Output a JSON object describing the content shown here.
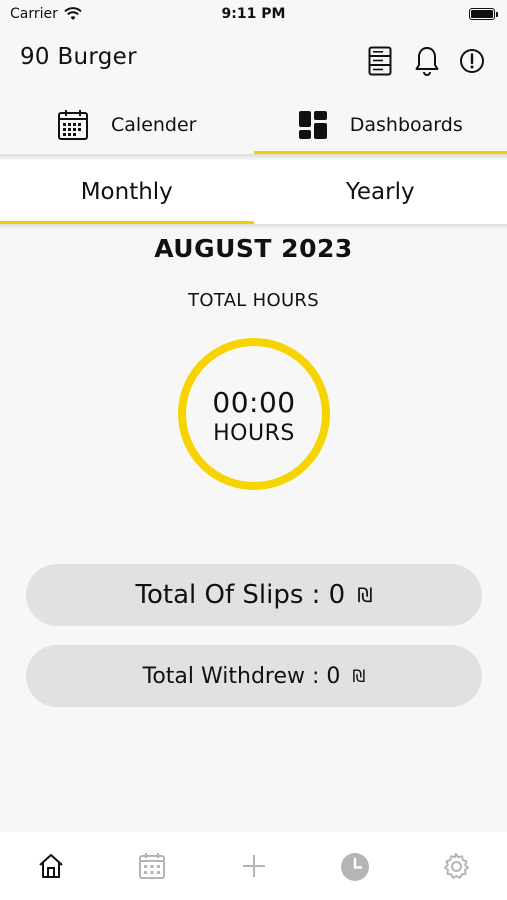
{
  "status_bar": {
    "carrier": "Carrier",
    "time": "9:11 PM",
    "battery_level": 1.0
  },
  "header": {
    "title": "90 Burger",
    "icons": [
      "list-icon",
      "bell-icon",
      "alert-icon"
    ]
  },
  "main_tabs": [
    {
      "label": "Calender",
      "icon": "calendar-icon",
      "active": false
    },
    {
      "label": "Dashboards",
      "icon": "dashboard-icon",
      "active": true
    }
  ],
  "sub_tabs": [
    {
      "label": "Monthly",
      "active": true
    },
    {
      "label": "Yearly",
      "active": false
    }
  ],
  "dashboard": {
    "month_title": "AUGUST 2023",
    "total_hours_label": "TOTAL HOURS",
    "hours_value": "00:00",
    "hours_unit": "HOURS",
    "slips_text": "Total Of Slips : 0",
    "withdrew_text": "Total Withdrew : 0",
    "currency_symbol": "₪"
  },
  "bottom_nav": {
    "items": [
      "home-icon",
      "calendar-icon",
      "plus-icon",
      "clock-icon",
      "settings-icon"
    ],
    "active": "home-icon"
  },
  "colors": {
    "accent": "#f2cf00",
    "ring": "#f7d300",
    "pill": "#e1e1e1",
    "inactive_icon": "#b5b5b5"
  }
}
